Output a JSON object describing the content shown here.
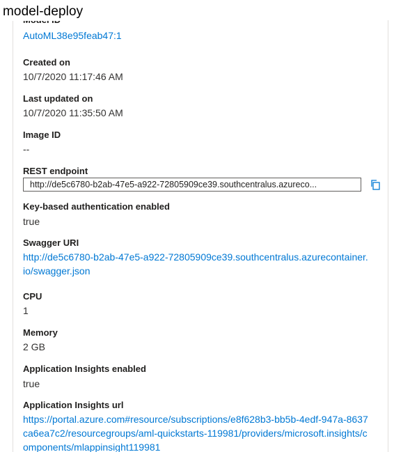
{
  "header": {
    "title": "model-deploy"
  },
  "properties": {
    "model_id_label": "Model ID",
    "model_id_value": "AutoML38e95feab47:1",
    "created_on_label": "Created on",
    "created_on_value": "10/7/2020 11:17:46 AM",
    "last_updated_label": "Last updated on",
    "last_updated_value": "10/7/2020 11:35:50 AM",
    "image_id_label": "Image ID",
    "image_id_value": "--",
    "rest_endpoint_label": "REST endpoint",
    "rest_endpoint_value": "http://de5c6780-b2ab-47e5-a922-72805909ce39.southcentralus.azureco...",
    "key_auth_label": "Key-based authentication enabled",
    "key_auth_value": "true",
    "swagger_label": "Swagger URI",
    "swagger_value": "http://de5c6780-b2ab-47e5-a922-72805909ce39.southcentralus.azurecontainer.io/swagger.json",
    "cpu_label": "CPU",
    "cpu_value": "1",
    "memory_label": "Memory",
    "memory_value": "2 GB",
    "app_insights_enabled_label": "Application Insights enabled",
    "app_insights_enabled_value": "true",
    "app_insights_url_label": "Application Insights url",
    "app_insights_url_value": "https://portal.azure.com#resource/subscriptions/e8f628b3-bb5b-4edf-947a-8637ca6ea7c2/resourcegroups/aml-quickstarts-119981/providers/microsoft.insights/components/mlappinsight119981"
  },
  "icons": {
    "copy": "copy-icon"
  },
  "colors": {
    "link": "#0078d4",
    "label": "#201f1e",
    "value": "#323130"
  }
}
